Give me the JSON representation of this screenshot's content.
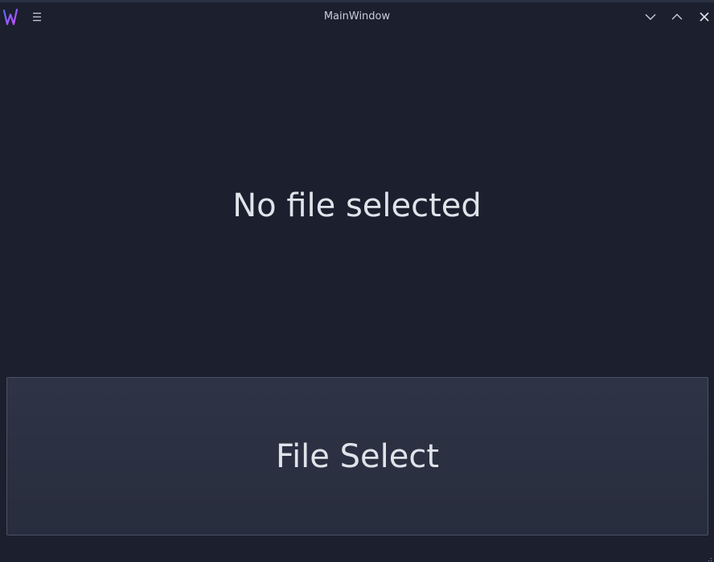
{
  "window": {
    "title": "MainWindow",
    "icons": {
      "app": "app-logo-w-icon",
      "menu": "hamburger-menu-icon",
      "minimize": "chevron-down-icon",
      "maximize": "chevron-up-icon",
      "close": "close-icon"
    }
  },
  "main": {
    "status_text": "No file selected",
    "file_select_label": "File Select"
  },
  "colors": {
    "background": "#1b1f2e",
    "button_bg": "#2e3446",
    "text": "#dfe3ea",
    "logo_gradient": [
      "#4d6bff",
      "#d24dff"
    ]
  }
}
